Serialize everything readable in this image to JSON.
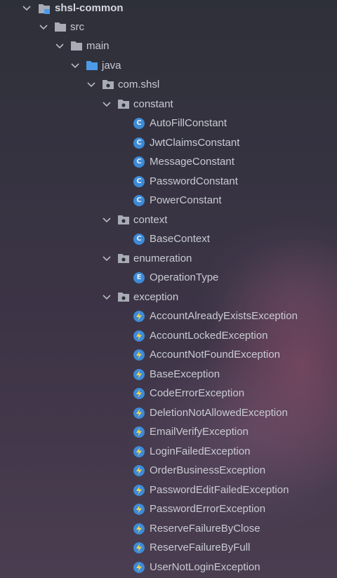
{
  "tree": {
    "module": {
      "label": "shsl-common"
    },
    "src": {
      "label": "src"
    },
    "main": {
      "label": "main"
    },
    "java": {
      "label": "java"
    },
    "package": {
      "label": "com.shsl"
    },
    "constant": {
      "label": "constant",
      "items": [
        "AutoFillConstant",
        "JwtClaimsConstant",
        "MessageConstant",
        "PasswordConstant",
        "PowerConstant"
      ]
    },
    "context": {
      "label": "context",
      "items": [
        "BaseContext"
      ]
    },
    "enumeration": {
      "label": "enumeration",
      "items": [
        "OperationType"
      ]
    },
    "exception": {
      "label": "exception",
      "items": [
        "AccountAlreadyExistsException",
        "AccountLockedException",
        "AccountNotFoundException",
        "BaseException",
        "CodeErrorException",
        "DeletionNotAllowedException",
        "EmailVerifyException",
        "LoginFailedException",
        "OrderBusinessException",
        "PasswordEditFailedException",
        "PasswordErrorException",
        "ReserveFailureByClose",
        "ReserveFailureByFull",
        "UserNotLoginException"
      ]
    }
  },
  "badges": {
    "class_letter": "C",
    "enum_letter": "E"
  },
  "colors": {
    "folder": "#a9acb6",
    "source_folder": "#4c9be8",
    "badge_blue": "#3d8bd8",
    "exception_bolt": "#f3d24a",
    "text": "#c9cbd3"
  }
}
